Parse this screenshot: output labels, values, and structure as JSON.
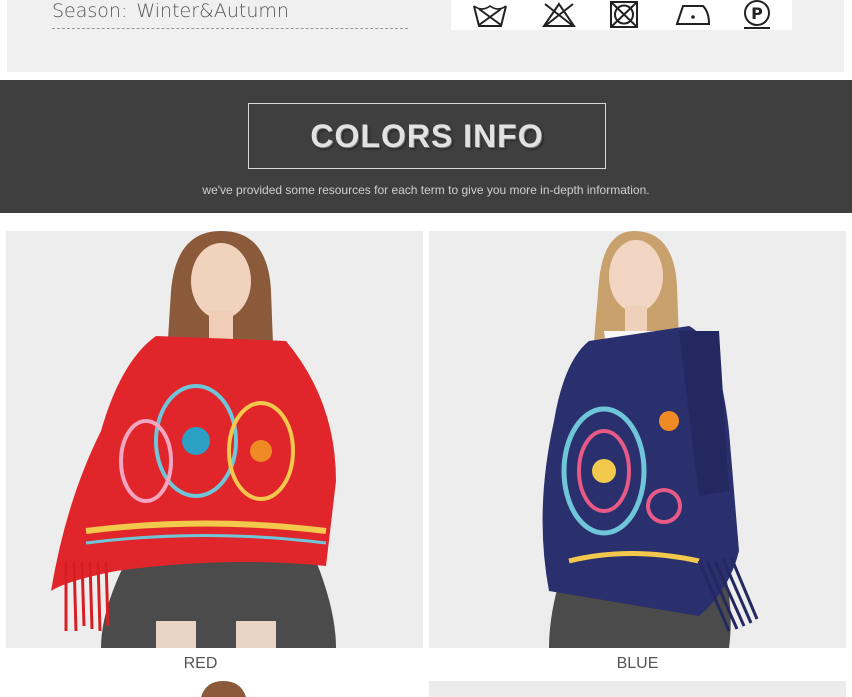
{
  "specs": {
    "season_label": "Season:",
    "season_value": "Winter&Autumn"
  },
  "care_icons": [
    "hand-wash-icon",
    "no-bleach-icon",
    "no-tumble-dry-icon",
    "low-iron-icon",
    "dry-clean-p-icon"
  ],
  "care_p_letter": "P",
  "colors_section": {
    "title": "COLORS INFO",
    "subtitle": "we've provided some resources for each term to give you more in-depth information."
  },
  "products": [
    {
      "label": "RED",
      "color": "#e0262b"
    },
    {
      "label": "BLUE",
      "color": "#2a2f6e"
    }
  ]
}
